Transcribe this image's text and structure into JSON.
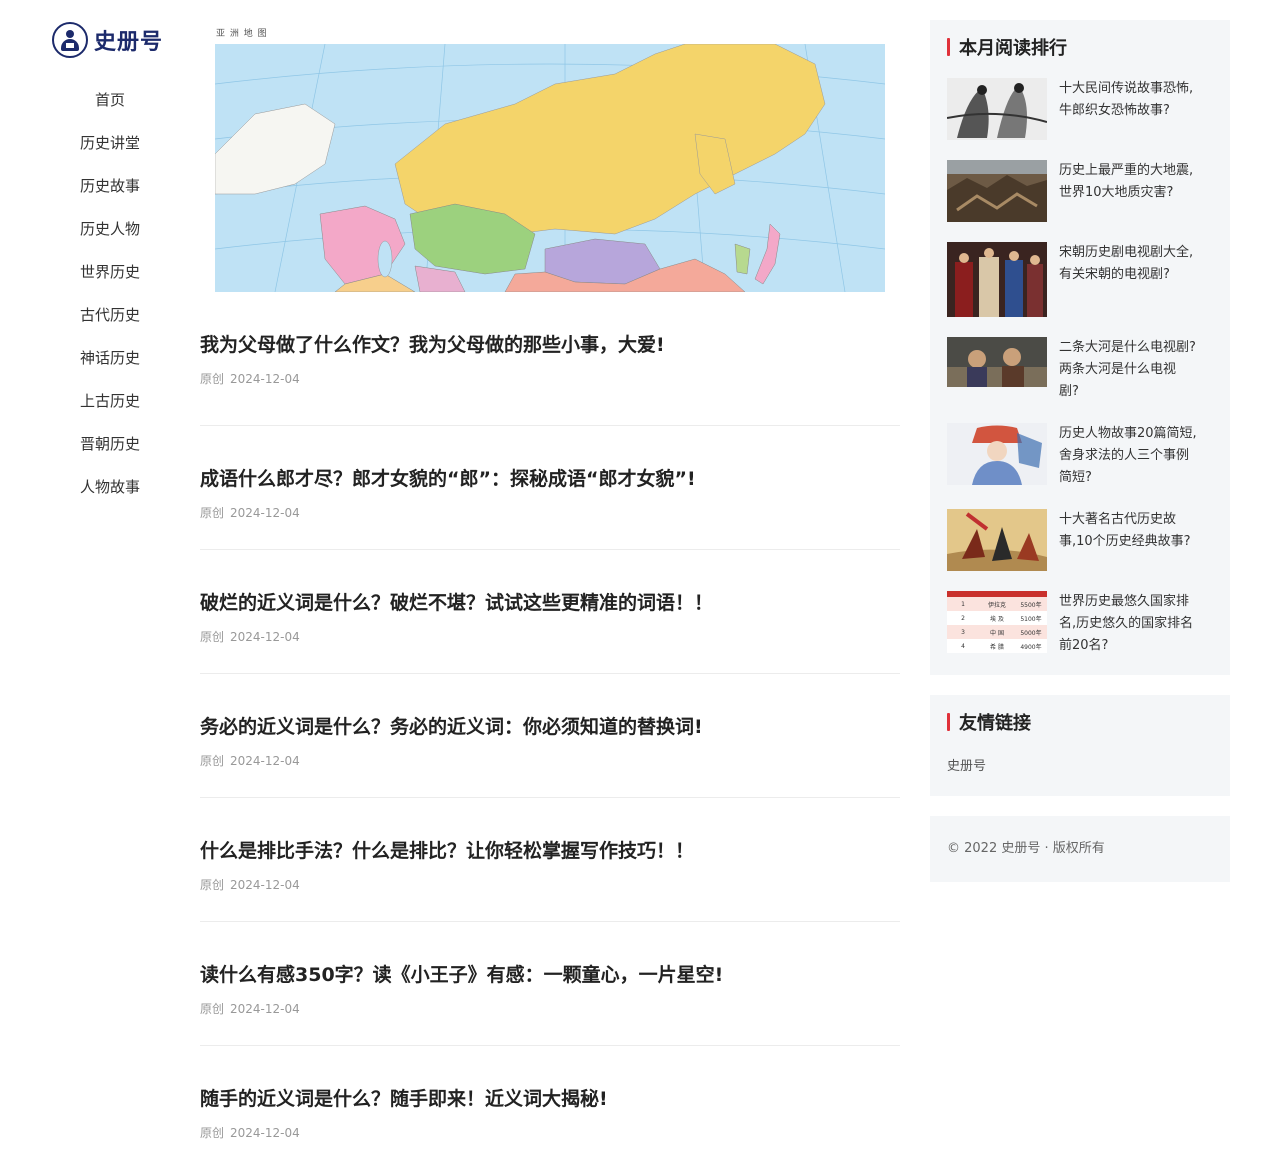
{
  "logo": {
    "text": "史册号"
  },
  "nav": [
    "首页",
    "历史讲堂",
    "历史故事",
    "历史人物",
    "世界历史",
    "古代历史",
    "神话历史",
    "上古历史",
    "晋朝历史",
    "人物故事"
  ],
  "hero": {
    "caption": "亚 洲 地 图"
  },
  "articles": [
    {
      "title": "我为父母做了什么作文？我为父母做的那些小事，大爱!",
      "source": "原创",
      "date": "2024-12-04"
    },
    {
      "title": "成语什么郎才尽？郎才女貌的“郎”：探秘成语“郎才女貌”!",
      "source": "原创",
      "date": "2024-12-04"
    },
    {
      "title": "破烂的近义词是什么？破烂不堪？试试这些更精准的词语！！",
      "source": "原创",
      "date": "2024-12-04"
    },
    {
      "title": "务必的近义词是什么？务必的近义词：你必须知道的替换词!",
      "source": "原创",
      "date": "2024-12-04"
    },
    {
      "title": "什么是排比手法？什么是排比？让你轻松掌握写作技巧！！",
      "source": "原创",
      "date": "2024-12-04"
    },
    {
      "title": "读什么有感350字？读《小王子》有感：一颗童心，一片星空!",
      "source": "原创",
      "date": "2024-12-04"
    },
    {
      "title": "随手的近义词是什么？随手即来！近义词大揭秘!",
      "source": "原创",
      "date": "2024-12-04"
    }
  ],
  "ranking": {
    "title": "本月阅读排行",
    "items": [
      {
        "lines": [
          "十大民间传说故事恐怖,",
          "牛郎织女恐怖故事?"
        ]
      },
      {
        "lines": [
          "历史上最严重的大地震,",
          "世界10大地质灾害?"
        ]
      },
      {
        "lines": [
          "宋朝历史剧电视剧大全,",
          "有关宋朝的电视剧?"
        ]
      },
      {
        "lines": [
          "二条大河是什么电视剧?",
          "两条大河是什么电视",
          "剧?"
        ]
      },
      {
        "lines": [
          "历史人物故事20篇简短,",
          "舍身求法的人三个事例",
          "简短?"
        ]
      },
      {
        "lines": [
          "十大著名古代历史故",
          "事,10个历史经典故事?"
        ]
      },
      {
        "lines": [
          "世界历史最悠久国家排",
          "名,历史悠久的国家排名",
          "前20名?"
        ]
      }
    ]
  },
  "friend_links": {
    "title": "友情链接",
    "items": [
      "史册号"
    ]
  },
  "footer": {
    "text": "© 2022 史册号 · 版权所有"
  },
  "thumb_table": {
    "rows": [
      [
        "1",
        "伊拉克",
        "5500年"
      ],
      [
        "2",
        "埃 及",
        "5100年"
      ],
      [
        "3",
        "中 国",
        "5000年"
      ],
      [
        "4",
        "希 腊",
        "4900年"
      ]
    ]
  },
  "colors": {
    "accent": "#e0313a",
    "logo": "#1c2a6b",
    "panel": "#f4f6f8"
  }
}
